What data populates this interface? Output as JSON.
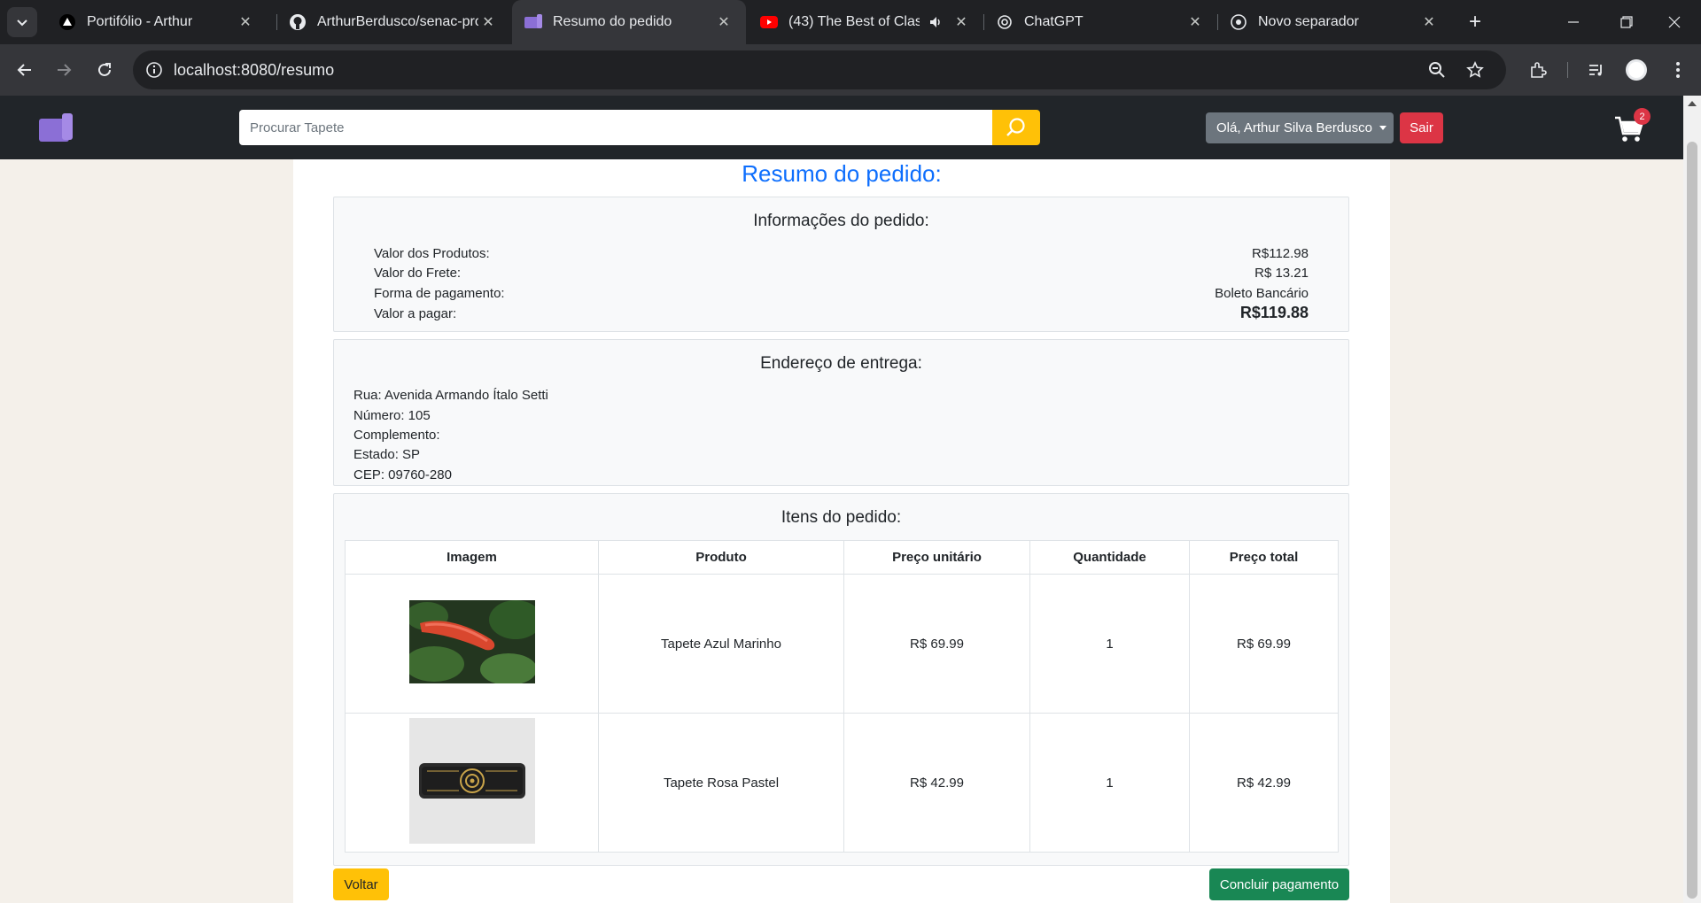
{
  "browser": {
    "tabs": [
      {
        "title": "Portifólio - Arthur",
        "icon": "triangle-icon",
        "active": false
      },
      {
        "title": "ArthurBerdusco/senac-proj",
        "icon": "github-icon",
        "active": false
      },
      {
        "title": "Resumo do pedido",
        "icon": "mat-logo-icon",
        "active": true
      },
      {
        "title": "(43) The Best of Classic",
        "icon": "youtube-icon",
        "active": false
      },
      {
        "title": "ChatGPT",
        "icon": "chatgpt-icon",
        "active": false
      },
      {
        "title": "Novo separador",
        "icon": "chrome-icon",
        "active": false
      }
    ],
    "url": "localhost:8080/resumo"
  },
  "navbar": {
    "search_placeholder": "Procurar Tapete",
    "user_label": "Olá, Arthur Silva Berdusco",
    "logout_label": "Sair",
    "cart_count": "2"
  },
  "page": {
    "title": "Resumo do pedido:"
  },
  "order_info": {
    "title": "Informações do pedido:",
    "rows": [
      {
        "label": "Valor dos Produtos:",
        "value": "R$112.98"
      },
      {
        "label": "Valor do Frete:",
        "value": "R$ 13.21"
      },
      {
        "label": "Forma de pagamento:",
        "value": "Boleto Bancário"
      },
      {
        "label": "Valor a pagar:",
        "value": "R$119.88"
      }
    ]
  },
  "address": {
    "title": "Endereço de entrega:",
    "lines": [
      "Rua: Avenida Armando Ítalo Setti",
      "Número: 105",
      "Complemento:",
      "Estado: SP",
      "CEP: 09760-280"
    ]
  },
  "items": {
    "title": "Itens do pedido:",
    "headers": [
      "Imagem",
      "Produto",
      "Preço unitário",
      "Quantidade",
      "Preço total"
    ],
    "rows": [
      {
        "product": "Tapete Azul Marinho",
        "unit_price": "R$ 69.99",
        "quantity": "1",
        "total": "R$ 69.99"
      },
      {
        "product": "Tapete Rosa Pastel",
        "unit_price": "R$ 42.99",
        "quantity": "1",
        "total": "R$ 42.99"
      }
    ]
  },
  "actions": {
    "back_label": "Voltar",
    "confirm_label": "Concluir pagamento"
  },
  "colors": {
    "primary": "#0d6efd",
    "warning": "#ffc107",
    "danger": "#dc3545",
    "success": "#198754",
    "navbar": "#212529",
    "logo": "#8b6fd6"
  }
}
